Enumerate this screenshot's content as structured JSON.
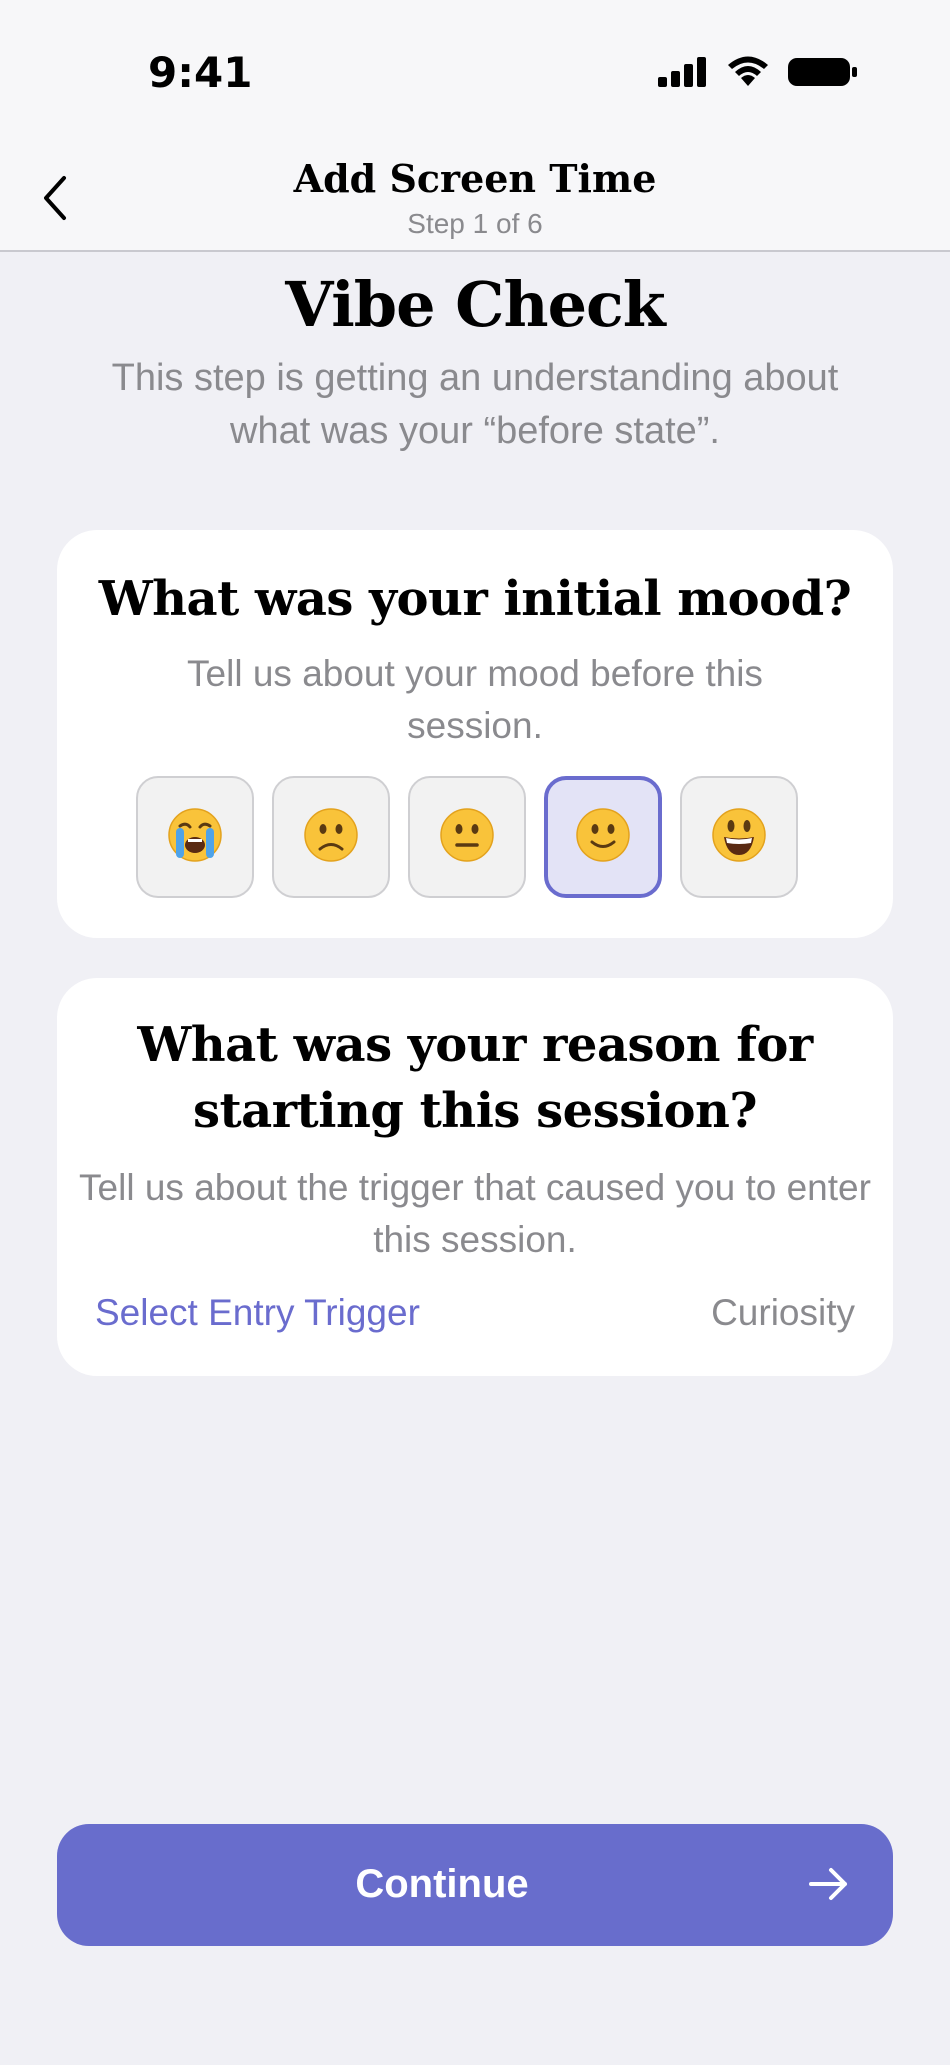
{
  "status_bar": {
    "time": "9:41",
    "icons": [
      "cellular-signal-icon",
      "wifi-icon",
      "battery-icon"
    ]
  },
  "nav": {
    "back_icon": "chevron-left-icon",
    "title": "Add Screen Time",
    "subtitle": "Step 1 of 6"
  },
  "page": {
    "title": "Vibe Check",
    "description": "This step is getting an understanding about what was your “before state”."
  },
  "mood_card": {
    "title": "What was your initial mood?",
    "description": "Tell us about your mood before this session.",
    "options": [
      {
        "icon": "crying-face-icon",
        "selected": false
      },
      {
        "icon": "frowning-face-icon",
        "selected": false
      },
      {
        "icon": "neutral-face-icon",
        "selected": false
      },
      {
        "icon": "slightly-smiling-face-icon",
        "selected": true
      },
      {
        "icon": "grinning-face-icon",
        "selected": false
      }
    ]
  },
  "trigger_card": {
    "title": "What was your reason for starting this session?",
    "description": "Tell us about the trigger that caused you to enter this session.",
    "select_label": "Select Entry Trigger",
    "selected_value": "Curiosity"
  },
  "continue_button": {
    "label": "Continue",
    "icon": "arrow-right-icon"
  },
  "colors": {
    "accent": "#686dcc",
    "background": "#f0f0f5",
    "secondary_text": "#8a8a8e",
    "card": "#ffffff"
  }
}
